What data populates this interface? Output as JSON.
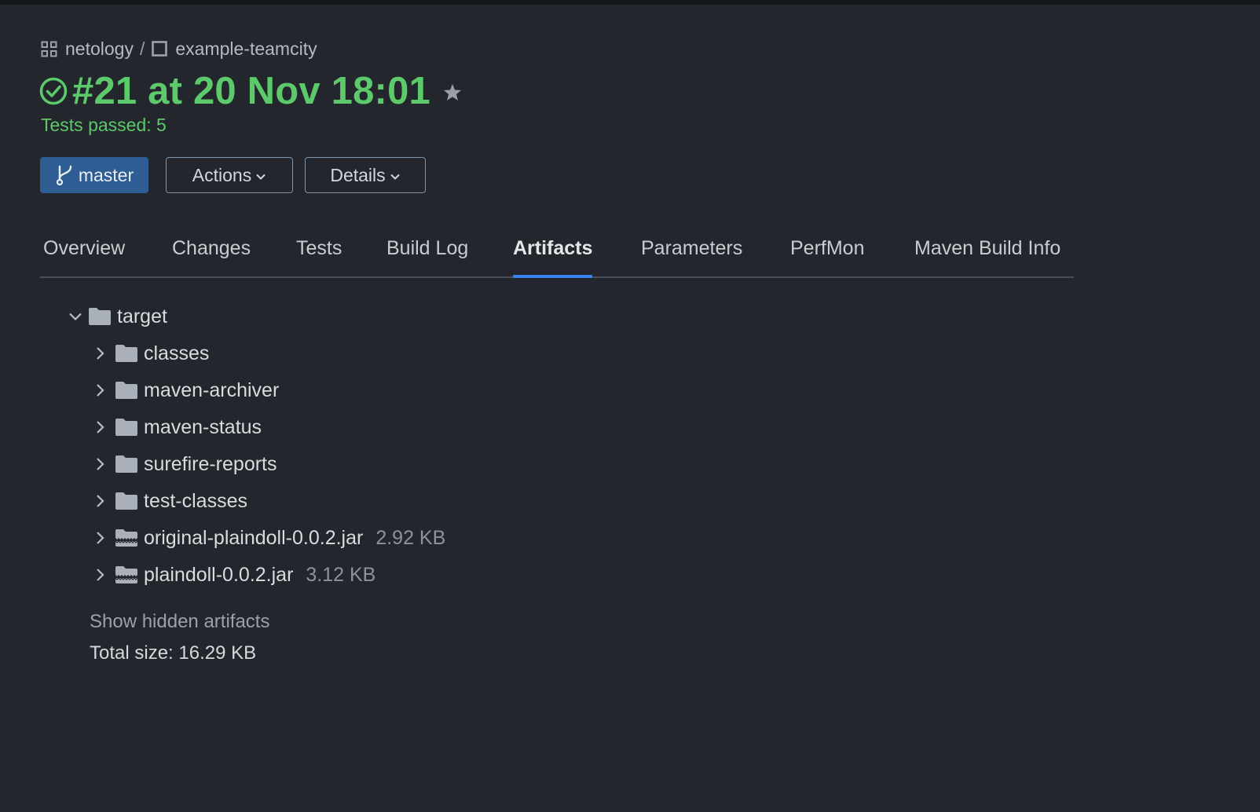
{
  "breadcrumb": {
    "project": "netology",
    "separator": "/",
    "build_config": "example-teamcity"
  },
  "build": {
    "title": "#21 at 20 Nov 18:01",
    "status": "success",
    "status_text": "Tests passed: 5",
    "branch": "master"
  },
  "buttons": {
    "actions": "Actions",
    "details": "Details"
  },
  "tabs": [
    {
      "label": "Overview",
      "active": false
    },
    {
      "label": "Changes",
      "active": false
    },
    {
      "label": "Tests",
      "active": false
    },
    {
      "label": "Build Log",
      "active": false
    },
    {
      "label": "Artifacts",
      "active": true
    },
    {
      "label": "Parameters",
      "active": false
    },
    {
      "label": "PerfMon",
      "active": false
    },
    {
      "label": "Maven Build Info",
      "active": false
    }
  ],
  "artifacts": {
    "root": {
      "name": "target",
      "expanded": true
    },
    "children": [
      {
        "name": "classes",
        "type": "folder"
      },
      {
        "name": "maven-archiver",
        "type": "folder"
      },
      {
        "name": "maven-status",
        "type": "folder"
      },
      {
        "name": "surefire-reports",
        "type": "folder"
      },
      {
        "name": "test-classes",
        "type": "folder"
      },
      {
        "name": "original-plaindoll-0.0.2.jar",
        "type": "archive",
        "size": "2.92 KB"
      },
      {
        "name": "plaindoll-0.0.2.jar",
        "type": "archive",
        "size": "3.12 KB"
      }
    ],
    "show_hidden": "Show hidden artifacts",
    "total_size": "Total size: 16.29 KB"
  },
  "colors": {
    "background": "#23262c",
    "success": "#5cc96b",
    "branch_button": "#2e5d93",
    "active_tab_underline": "#3b82f6",
    "folder_icon": "#a9b0ba"
  }
}
